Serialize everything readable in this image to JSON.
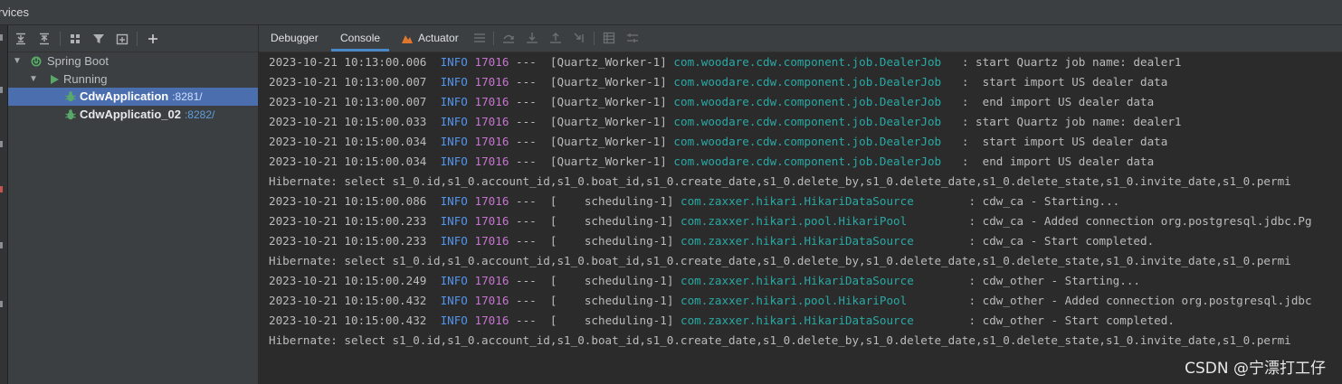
{
  "window": {
    "title": "rvices"
  },
  "services": {
    "toolbar": {
      "expand_all_icon": "expand-all-icon",
      "collapse_all_icon": "collapse-all-icon",
      "group_icon": "group-by-icon",
      "filter_icon": "filter-icon",
      "new_tab_icon": "open-in-new-tab-icon",
      "add_icon": "add-service-icon"
    },
    "tree": [
      {
        "label": "Spring Boot",
        "level": 0
      },
      {
        "label": "Running",
        "level": 1
      },
      {
        "label": "CdwApplication",
        "port": ":8281/",
        "level": 2,
        "selected": true
      },
      {
        "label": "CdwApplicatio_02",
        "port": ":8282/",
        "level": 2,
        "selected": false
      }
    ]
  },
  "console": {
    "tabs": [
      {
        "label": "Debugger",
        "active": false
      },
      {
        "label": "Console",
        "active": true
      },
      {
        "label": "Actuator",
        "active": false
      }
    ],
    "lines": [
      {
        "type": "log",
        "ts": "2023-10-21 10:13:00.006",
        "level": "INFO",
        "pid": "17016",
        "thread": "---  [Quartz_Worker-1]",
        "logger": "com.woodare.cdw.component.job.DealerJob ",
        "msg": "  : start Quartz job name: dealer1"
      },
      {
        "type": "log",
        "ts": "2023-10-21 10:13:00.007",
        "level": "INFO",
        "pid": "17016",
        "thread": "---  [Quartz_Worker-1]",
        "logger": "com.woodare.cdw.component.job.DealerJob ",
        "msg": "  :  start import US dealer data"
      },
      {
        "type": "log",
        "ts": "2023-10-21 10:13:00.007",
        "level": "INFO",
        "pid": "17016",
        "thread": "---  [Quartz_Worker-1]",
        "logger": "com.woodare.cdw.component.job.DealerJob ",
        "msg": "  :  end import US dealer data"
      },
      {
        "type": "log",
        "ts": "2023-10-21 10:15:00.033",
        "level": "INFO",
        "pid": "17016",
        "thread": "---  [Quartz_Worker-1]",
        "logger": "com.woodare.cdw.component.job.DealerJob ",
        "msg": "  : start Quartz job name: dealer1"
      },
      {
        "type": "log",
        "ts": "2023-10-21 10:15:00.034",
        "level": "INFO",
        "pid": "17016",
        "thread": "---  [Quartz_Worker-1]",
        "logger": "com.woodare.cdw.component.job.DealerJob ",
        "msg": "  :  start import US dealer data"
      },
      {
        "type": "log",
        "ts": "2023-10-21 10:15:00.034",
        "level": "INFO",
        "pid": "17016",
        "thread": "---  [Quartz_Worker-1]",
        "logger": "com.woodare.cdw.component.job.DealerJob ",
        "msg": "  :  end import US dealer data"
      },
      {
        "type": "plain",
        "text": "Hibernate: select s1_0.id,s1_0.account_id,s1_0.boat_id,s1_0.create_date,s1_0.delete_by,s1_0.delete_date,s1_0.delete_state,s1_0.invite_date,s1_0.permi"
      },
      {
        "type": "log",
        "ts": "2023-10-21 10:15:00.086",
        "level": "INFO",
        "pid": "17016",
        "thread": "---  [    scheduling-1]",
        "logger": "com.zaxxer.hikari.HikariDataSource      ",
        "msg": "  : cdw_ca - Starting..."
      },
      {
        "type": "log",
        "ts": "2023-10-21 10:15:00.233",
        "level": "INFO",
        "pid": "17016",
        "thread": "---  [    scheduling-1]",
        "logger": "com.zaxxer.hikari.pool.HikariPool       ",
        "msg": "  : cdw_ca - Added connection org.postgresql.jdbc.Pg"
      },
      {
        "type": "log",
        "ts": "2023-10-21 10:15:00.233",
        "level": "INFO",
        "pid": "17016",
        "thread": "---  [    scheduling-1]",
        "logger": "com.zaxxer.hikari.HikariDataSource      ",
        "msg": "  : cdw_ca - Start completed."
      },
      {
        "type": "plain",
        "text": "Hibernate: select s1_0.id,s1_0.account_id,s1_0.boat_id,s1_0.create_date,s1_0.delete_by,s1_0.delete_date,s1_0.delete_state,s1_0.invite_date,s1_0.permi"
      },
      {
        "type": "log",
        "ts": "2023-10-21 10:15:00.249",
        "level": "INFO",
        "pid": "17016",
        "thread": "---  [    scheduling-1]",
        "logger": "com.zaxxer.hikari.HikariDataSource      ",
        "msg": "  : cdw_other - Starting..."
      },
      {
        "type": "log",
        "ts": "2023-10-21 10:15:00.432",
        "level": "INFO",
        "pid": "17016",
        "thread": "---  [    scheduling-1]",
        "logger": "com.zaxxer.hikari.pool.HikariPool       ",
        "msg": "  : cdw_other - Added connection org.postgresql.jdbc"
      },
      {
        "type": "log",
        "ts": "2023-10-21 10:15:00.432",
        "level": "INFO",
        "pid": "17016",
        "thread": "---  [    scheduling-1]",
        "logger": "com.zaxxer.hikari.HikariDataSource      ",
        "msg": "  : cdw_other - Start completed."
      },
      {
        "type": "plain",
        "text": "Hibernate: select s1_0.id,s1_0.account_id,s1_0.boat_id,s1_0.create_date,s1_0.delete_by,s1_0.delete_date,s1_0.delete_state,s1_0.invite_date,s1_0.permi"
      }
    ]
  },
  "watermark": "CSDN @宁漂打工仔",
  "colors": {
    "log_level": "#5394ec",
    "pid": "#c674cf",
    "logger": "#29a9a4",
    "selection": "#4b6eaf",
    "run_green": "#59a869"
  }
}
